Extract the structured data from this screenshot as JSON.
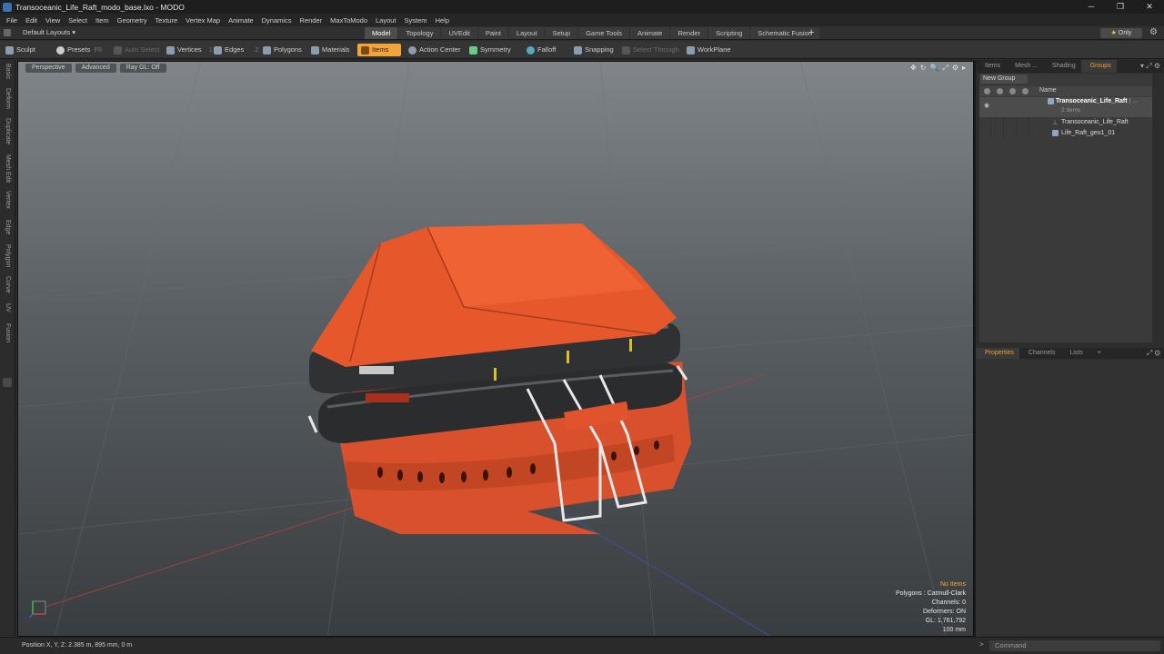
{
  "window": {
    "title": "Transoceanic_Life_Raft_modo_base.lxo - MODO",
    "controls": [
      "─",
      "❐",
      "✕"
    ]
  },
  "menu": [
    "File",
    "Edit",
    "View",
    "Select",
    "Item",
    "Geometry",
    "Texture",
    "Vertex Map",
    "Animate",
    "Dynamics",
    "Render",
    "MaxToModo",
    "Layout",
    "System",
    "Help"
  ],
  "layout_selector": "Default Layouts ▾",
  "mode_tabs": [
    {
      "label": "Model",
      "active": true
    },
    {
      "label": "Topology",
      "active": false
    },
    {
      "label": "UVEdit",
      "active": false
    },
    {
      "label": "Paint",
      "active": false
    },
    {
      "label": "Layout",
      "active": false
    },
    {
      "label": "Setup",
      "active": false
    },
    {
      "label": "Game Tools",
      "active": false
    },
    {
      "label": "Animate",
      "active": false
    },
    {
      "label": "Render",
      "active": false
    },
    {
      "label": "Scripting",
      "active": false
    },
    {
      "label": "Schematic Fusion",
      "active": false
    }
  ],
  "add_tab": "+",
  "only_button": {
    "star": "★",
    "label": "Only"
  },
  "toolbar": {
    "sculpt": "Sculpt",
    "presets": "Presets",
    "presets_key": "F6",
    "auto_select": "Auto Select",
    "vertices": "Vertices",
    "vertices_key": "1",
    "edges": "Edges",
    "edges_key": "2",
    "polygons": "Polygons",
    "materials": "Materials",
    "items": "Items",
    "action_center": "Action Center",
    "symmetry": "Symmetry",
    "falloff": "Falloff",
    "snapping": "Snapping",
    "select_through": "Select Through",
    "workplane": "WorkPlane"
  },
  "left_tabs": [
    "Basic",
    "Deform",
    "Duplicate",
    "Mesh Edit",
    "Vertex",
    "Edge",
    "Polygon",
    "Curve",
    "UV",
    "Fusion"
  ],
  "viewport": {
    "buttons": [
      "Perspective",
      "Advanced",
      "Ray GL: Off"
    ],
    "icons": [
      "✥",
      "↻",
      "🔍",
      "⤢",
      "⚙",
      "▸"
    ],
    "stats": {
      "selection": "No Items",
      "polygons": "Polygons : Catmull-Clark",
      "channels": "Channels: 0",
      "deformers": "Deformers: ON",
      "gl": "GL: 1,761,792",
      "scale": "100 mm"
    }
  },
  "status": {
    "position": "Position X, Y, Z:   2.385 m, 895 mm, 0 m",
    "command_placeholder": "Command",
    "arrow": ">"
  },
  "right_panel": {
    "tabs": [
      {
        "label": "Items",
        "active": false
      },
      {
        "label": "Mesh ...",
        "active": false
      },
      {
        "label": "Shading",
        "active": false
      },
      {
        "label": "Groups",
        "active": true
      }
    ],
    "new_group": "New Group",
    "name_header": "Name",
    "group": {
      "name": "Transoceanic_Life_Raft",
      "suffix": "( ...",
      "count": "2 Items"
    },
    "children": [
      "Transoceanic_Life_Raft",
      "Life_Raft_geo1_01"
    ],
    "lower_tabs": [
      {
        "label": "Properties",
        "active": true
      },
      {
        "label": "Channels",
        "active": false
      },
      {
        "label": "Lists",
        "active": false
      }
    ],
    "add": "+"
  },
  "colors": {
    "accent": "#f2a33a",
    "raft_orange": "#e8552c",
    "dark_tube": "#2a2c2e",
    "viewport_top": "#7f8589",
    "viewport_bottom": "#3a3d40"
  }
}
